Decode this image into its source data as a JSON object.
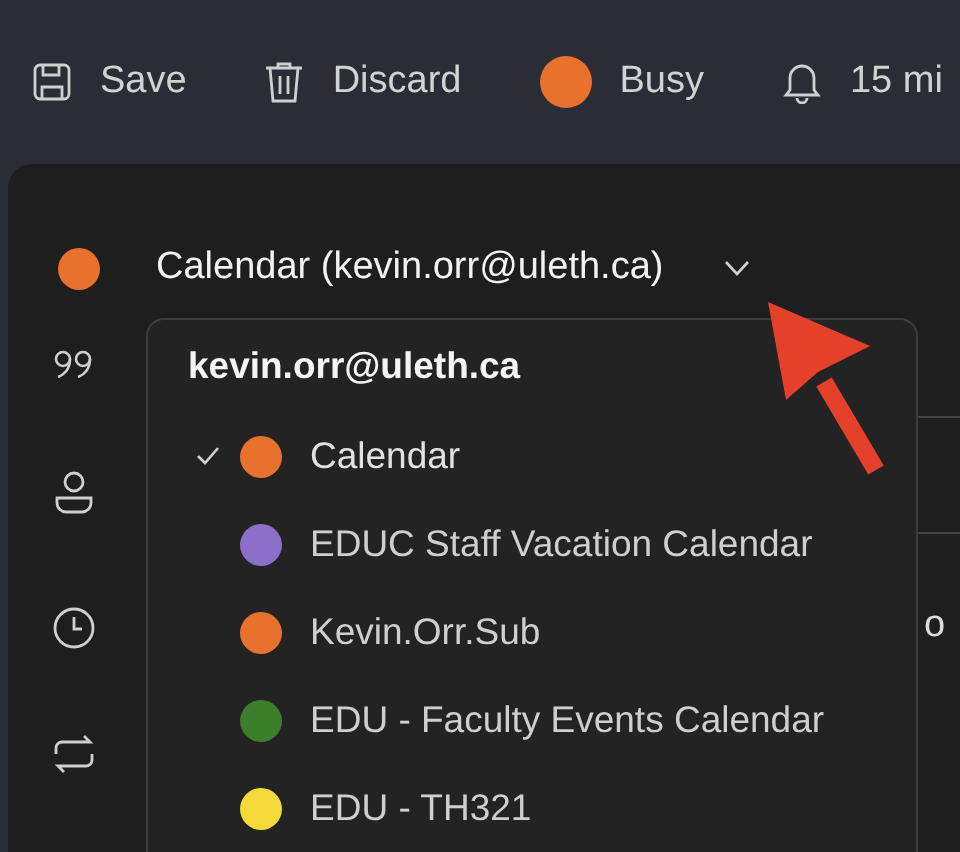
{
  "toolbar": [
    {
      "kind": "save",
      "label": "Save"
    },
    {
      "kind": "discard",
      "label": "Discard"
    },
    {
      "kind": "status",
      "label": "Busy",
      "color": "#e8712d"
    },
    {
      "kind": "reminder",
      "label": "15 mi"
    }
  ],
  "calendar_picker": {
    "label": "Calendar (kevin.orr@uleth.ca)",
    "color": "#e8712d",
    "expanded": true
  },
  "background_text": "o",
  "dropdown": {
    "account": "kevin.orr@uleth.ca",
    "items": [
      {
        "label": "Calendar",
        "color": "#e8712d",
        "selected": true
      },
      {
        "label": "EDUC Staff Vacation Calendar",
        "color": "#8c6fc9",
        "selected": false
      },
      {
        "label": "Kevin.Orr.Sub",
        "color": "#e8712d",
        "selected": false
      },
      {
        "label": "EDU - Faculty Events Calendar",
        "color": "#3b7f2a",
        "selected": false
      },
      {
        "label": "EDU - TH321",
        "color": "#f5d83a",
        "selected": false
      }
    ]
  }
}
